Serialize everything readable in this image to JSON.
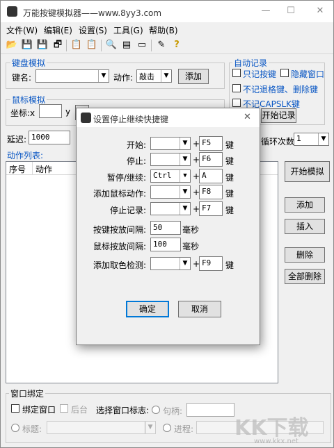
{
  "window": {
    "title": "万能按键模拟器——www.8yy3.com",
    "minimize": "—",
    "maximize": "☐",
    "close": "✕"
  },
  "menu": [
    "文件(W)",
    "编辑(E)",
    "设置(S)",
    "工具(G)",
    "帮助(B)"
  ],
  "keyboard": {
    "group": "键盘模拟",
    "key_label": "键名:",
    "key_value": "",
    "action_label": "动作:",
    "action_value": "敲击",
    "add": "添加"
  },
  "mouse": {
    "group": "鼠标模拟",
    "coord_label": "坐标:x",
    "y_label": "y"
  },
  "auto": {
    "group": "自动记录",
    "opt1": "只记按键",
    "opt2": "隐藏窗口",
    "opt3": "不记退格键、删除键",
    "opt4": "不记CAPSLK键",
    "start": "开始记录"
  },
  "delay": {
    "label": "延迟:",
    "value": "1000"
  },
  "loop": {
    "label": "循环次数:",
    "value": "1"
  },
  "actions": {
    "label": "动作列表:",
    "col_no": "序号",
    "col_action": "动作"
  },
  "side": {
    "start_sim": "开始模拟",
    "add": "添加",
    "insert": "插入",
    "delete": "删除",
    "delete_all": "全部删除"
  },
  "bind": {
    "group": "窗口绑定",
    "bind_window": "绑定窗口",
    "background": "后台",
    "select_label": "选择窗口标志:",
    "handle": "句柄:",
    "title": "标题:",
    "process": "进程:"
  },
  "dialog": {
    "title": "设置停止继续快捷键",
    "close": "✕",
    "rows": [
      {
        "label": "开始:",
        "mod": "",
        "key": "F5",
        "unit": "键"
      },
      {
        "label": "停止:",
        "mod": "",
        "key": "F6",
        "unit": "键"
      },
      {
        "label": "暂停/继续:",
        "mod": "Ctrl",
        "key": "A",
        "unit": "键"
      },
      {
        "label": "添加鼠标动作:",
        "mod": "",
        "key": "F8",
        "unit": "键"
      },
      {
        "label": "停止记录:",
        "mod": "",
        "key": "F7",
        "unit": "键"
      }
    ],
    "key_interval_label": "按键按放间隔:",
    "key_interval": "50",
    "mouse_interval_label": "鼠标按放间隔:",
    "mouse_interval": "100",
    "ms": "毫秒",
    "color_row": {
      "label": "添加取色检测:",
      "mod": "",
      "key": "F9",
      "unit": "键"
    },
    "plus": "+",
    "ok": "确定",
    "cancel": "取消"
  },
  "watermark": {
    "brand": "KK下载",
    "url": "www.kkx.net"
  }
}
